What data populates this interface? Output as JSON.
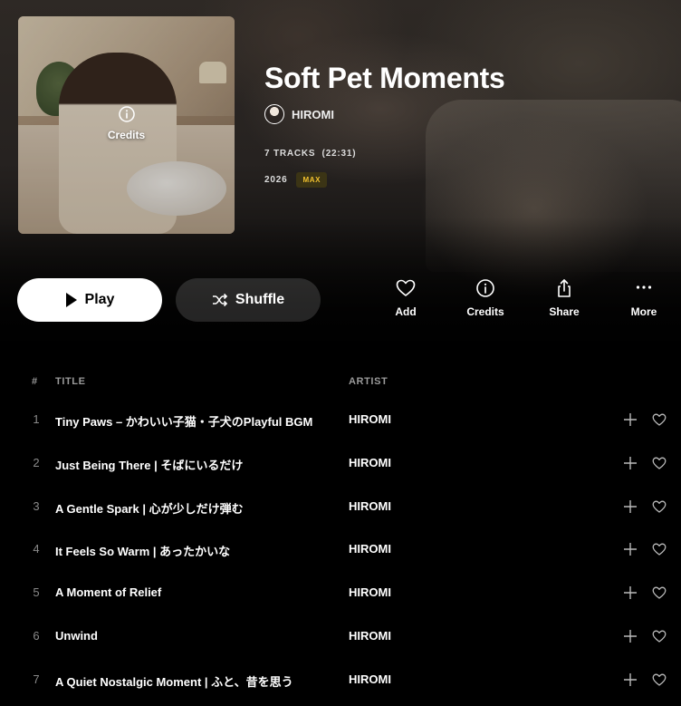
{
  "album": {
    "title": "Soft Pet Moments",
    "artist": "HIROMI",
    "tracks_meta": "7 TRACKS  (22:31)",
    "year": "2026",
    "quality_badge": "MAX",
    "cover_credits_label": "Credits"
  },
  "actions": {
    "play_label": "Play",
    "shuffle_label": "Shuffle",
    "add_label": "Add",
    "credits_label": "Credits",
    "share_label": "Share",
    "more_label": "More"
  },
  "table": {
    "headers": {
      "num": "#",
      "title": "TITLE",
      "artist": "ARTIST"
    },
    "rows": [
      {
        "num": "1",
        "title": "Tiny Paws – かわいい子猫・子犬のPlayful BGM",
        "artist": "HIROMI"
      },
      {
        "num": "2",
        "title": "Just Being There | そばにいるだけ",
        "artist": "HIROMI"
      },
      {
        "num": "3",
        "title": "A Gentle Spark | 心が少しだけ弾む",
        "artist": "HIROMI"
      },
      {
        "num": "4",
        "title": "It Feels So Warm | あったかいな",
        "artist": "HIROMI"
      },
      {
        "num": "5",
        "title": "A Moment of Relief",
        "artist": "HIROMI"
      },
      {
        "num": "6",
        "title": "Unwind",
        "artist": "HIROMI"
      },
      {
        "num": "7",
        "title": "A Quiet Nostalgic Moment | ふと、昔を思う",
        "artist": "HIROMI"
      }
    ]
  },
  "icons": {
    "play": "play-icon",
    "shuffle": "shuffle-icon",
    "add": "heart-icon",
    "credits": "info-icon",
    "share": "share-icon",
    "more": "more-dots-icon",
    "row_add": "plus-icon",
    "row_like": "heart-icon"
  },
  "colors": {
    "background": "#000000",
    "badge_text": "#f2c12e",
    "badge_bg": "#3b3415",
    "play_button_bg": "#ffffff",
    "muted_text": "#9a9a9a"
  }
}
